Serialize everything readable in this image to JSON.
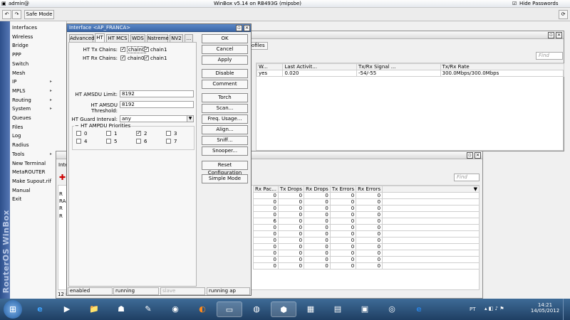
{
  "titlebar": {
    "session": "admin@",
    "title": "WinBox v5.14 on RB493G (mipsbe)",
    "hide_passwords": "Hide Passwords",
    "hide_passwords_checked": true
  },
  "toolbar": {
    "safe_mode": "Safe Mode"
  },
  "sidebar": {
    "brand": "RouterOS WinBox",
    "items": [
      {
        "label": "Interfaces",
        "has_sub": false
      },
      {
        "label": "Wireless",
        "has_sub": false
      },
      {
        "label": "Bridge",
        "has_sub": false
      },
      {
        "label": "PPP",
        "has_sub": false
      },
      {
        "label": "Switch",
        "has_sub": false
      },
      {
        "label": "Mesh",
        "has_sub": false
      },
      {
        "label": "IP",
        "has_sub": true
      },
      {
        "label": "MPLS",
        "has_sub": true
      },
      {
        "label": "Routing",
        "has_sub": true
      },
      {
        "label": "System",
        "has_sub": true
      },
      {
        "label": "Queues",
        "has_sub": false
      },
      {
        "label": "Files",
        "has_sub": false
      },
      {
        "label": "Log",
        "has_sub": false
      },
      {
        "label": "Radius",
        "has_sub": false
      },
      {
        "label": "Tools",
        "has_sub": true
      },
      {
        "label": "New Terminal",
        "has_sub": false
      },
      {
        "label": "MetaROUTER",
        "has_sub": false
      },
      {
        "label": "Make Supout.rif",
        "has_sub": false
      },
      {
        "label": "Manual",
        "has_sub": false
      },
      {
        "label": "Exit",
        "has_sub": false
      }
    ]
  },
  "wireless_window": {
    "tab_partial": "ofiles",
    "find": "Find",
    "columns": [
      "W...",
      "Last Activit...",
      "Tx/Rx Signal ...",
      "Tx/Rx Rate"
    ],
    "row": [
      "yes",
      "0.020",
      "-54/-55",
      "300.0Mbps/300.0Mbps"
    ]
  },
  "interface_window": {
    "tab_partial": "Inte",
    "find": "Find",
    "row_prefixes": [
      "R",
      "RA",
      "R",
      "R"
    ],
    "columns": [
      "Rx Pac...",
      "Tx Drops",
      "Rx Drops",
      "Tx Errors",
      "Rx Errors"
    ],
    "rows": [
      [
        "0",
        "0",
        "0",
        "0",
        "0"
      ],
      [
        "0",
        "0",
        "0",
        "0",
        "0"
      ],
      [
        "0",
        "0",
        "0",
        "0",
        "0"
      ],
      [
        "0",
        "0",
        "0",
        "0",
        "0"
      ],
      [
        "6",
        "0",
        "0",
        "0",
        "0"
      ],
      [
        "0",
        "0",
        "0",
        "0",
        "0"
      ],
      [
        "0",
        "0",
        "0",
        "0",
        "0"
      ],
      [
        "0",
        "0",
        "0",
        "0",
        "0"
      ],
      [
        "0",
        "0",
        "0",
        "0",
        "0"
      ],
      [
        "0",
        "0",
        "0",
        "0",
        "0"
      ],
      [
        "0",
        "0",
        "0",
        "0",
        "0"
      ],
      [
        "0",
        "0",
        "0",
        "0",
        "0"
      ]
    ],
    "count": "12 items"
  },
  "dialog": {
    "title": "Interface <AP_FRANCA>",
    "tabs": [
      "Advanced",
      "HT",
      "HT MCS",
      "WDS",
      "Nstreme",
      "NV2",
      "..."
    ],
    "active_tab": "HT",
    "tx_chains_label": "HT Tx Chains:",
    "rx_chains_label": "HT Rx Chains:",
    "chain0": "chain0",
    "chain1": "chain1",
    "amsdu_limit_label": "HT AMSDU Limit:",
    "amsdu_limit": "8192",
    "amsdu_threshold_label": "HT AMSDU Threshold:",
    "amsdu_threshold": "8192",
    "guard_label": "HT Guard Interval:",
    "guard_value": "any",
    "ampdu_label": "HT AMPDU Priorities",
    "priorities": [
      {
        "label": "0",
        "checked": false
      },
      {
        "label": "1",
        "checked": false
      },
      {
        "label": "2",
        "checked": true
      },
      {
        "label": "3",
        "checked": false
      },
      {
        "label": "4",
        "checked": false
      },
      {
        "label": "5",
        "checked": false
      },
      {
        "label": "6",
        "checked": false
      },
      {
        "label": "7",
        "checked": false
      }
    ],
    "buttons": [
      "OK",
      "Cancel",
      "Apply",
      "Disable",
      "Comment",
      "Torch",
      "Scan...",
      "Freq. Usage...",
      "Align...",
      "Sniff...",
      "Snooper...",
      "Reset Configuration",
      "Simple Mode"
    ],
    "status": [
      "enabled",
      "running",
      "slave",
      "running ap"
    ]
  },
  "taskbar": {
    "lang": "PT",
    "time": "14:21",
    "date": "14/05/2012"
  }
}
